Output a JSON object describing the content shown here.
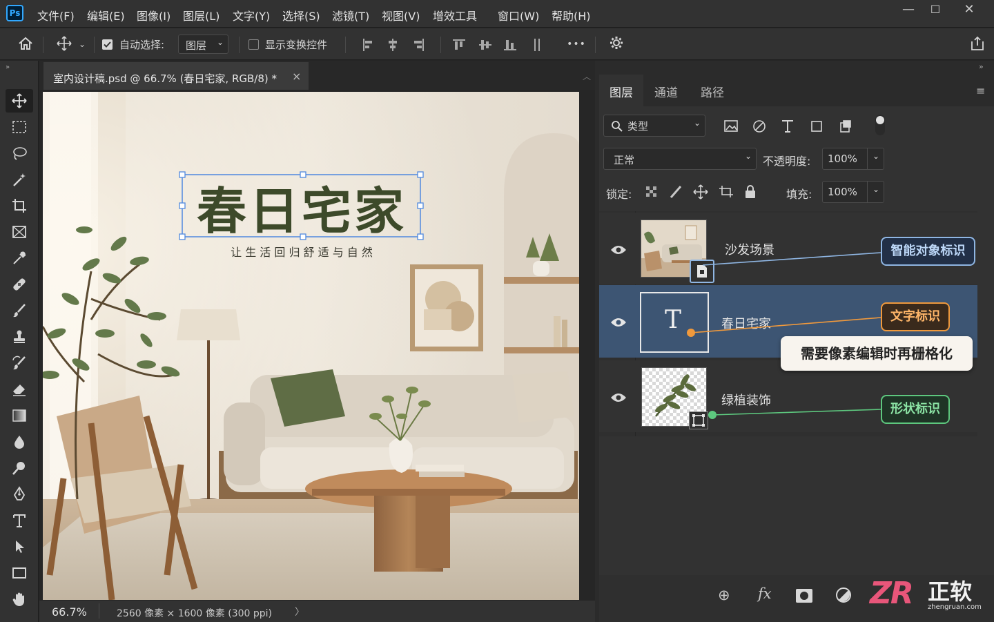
{
  "app": {
    "logo": "Ps"
  },
  "menu": [
    "文件(F)",
    "编辑(E)",
    "图像(I)",
    "图层(L)",
    "文字(Y)",
    "选择(S)",
    "滤镜(T)",
    "视图(V)",
    "增效工具",
    "窗口(W)",
    "帮助(H)"
  ],
  "window_controls": {
    "minimize": "—",
    "maximize": "☐",
    "close": "✕"
  },
  "options": {
    "auto_select_label": "自动选择:",
    "auto_select_checked": true,
    "auto_select_target": "图层",
    "show_transform_label": "显示变换控件",
    "show_transform_checked": false,
    "more": "•••"
  },
  "document": {
    "tab_title": "室内设计稿.psd @ 66.7% (春日宅家, RGB/8) *",
    "close": "×",
    "zoom": "66.7%",
    "dimensions": "2560 像素 × 1600 像素 (300 ppi)",
    "status_arrow": "〉"
  },
  "canvas": {
    "headline": "春日宅家",
    "tagline": "让 生 活 回 归 舒 适 与 自 然"
  },
  "layers_panel": {
    "tabs": [
      "图层",
      "通道",
      "路径"
    ],
    "filter_kind": "类型",
    "blend_mode": "正常",
    "opacity_label": "不透明度:",
    "opacity_value": "100%",
    "lock_label": "锁定:",
    "fill_label": "填充:",
    "fill_value": "100%",
    "layers": [
      {
        "name": "沙发场景",
        "type": "smart-object",
        "visible": true,
        "selected": false
      },
      {
        "name": "春日宅家",
        "type": "text",
        "visible": true,
        "selected": true
      },
      {
        "name": "绿植装饰",
        "type": "shape",
        "visible": true,
        "selected": false
      }
    ],
    "text_thumb_glyph": "T",
    "bottom": [
      "⊕",
      "fx"
    ]
  },
  "annotations": {
    "smart_object": "智能对象标识",
    "text": "文字标识",
    "text_tip": "需要像素编辑时再栅格化",
    "shape": "形状标识"
  },
  "watermark": {
    "text": "正软",
    "sub": "zhengruan.com",
    "logo": "ZR"
  },
  "colors": {
    "selected_layer": "#3d5573",
    "smart_callout": "#8fb6e3",
    "text_callout": "#f0993c",
    "shape_callout": "#5dc77e",
    "headline": "#3d4a2a"
  }
}
